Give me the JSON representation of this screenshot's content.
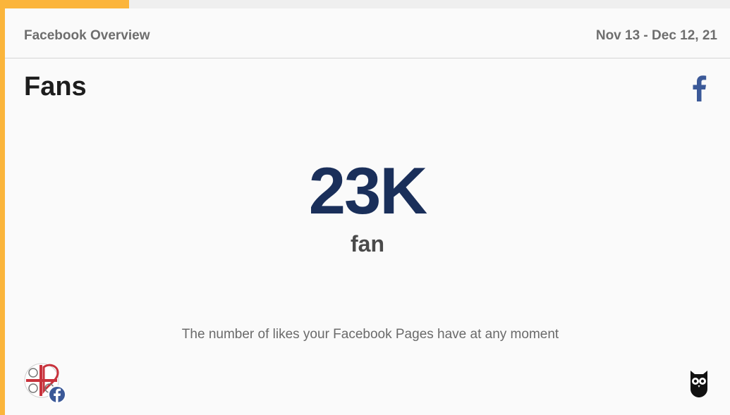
{
  "header": {
    "title": "Facebook Overview",
    "date_range": "Nov 13 - Dec 12, 21"
  },
  "metric": {
    "title": "Fans",
    "value": "23K",
    "unit": "fan",
    "description": "The number of likes your Facebook Pages have at any moment"
  },
  "icons": {
    "network": "facebook-icon",
    "page_avatar": "page-avatar-icon",
    "brand": "hootsuite-owl-icon"
  },
  "colors": {
    "accent": "#fbb53b",
    "value": "#1a2f5a",
    "facebook": "#3b5998"
  }
}
